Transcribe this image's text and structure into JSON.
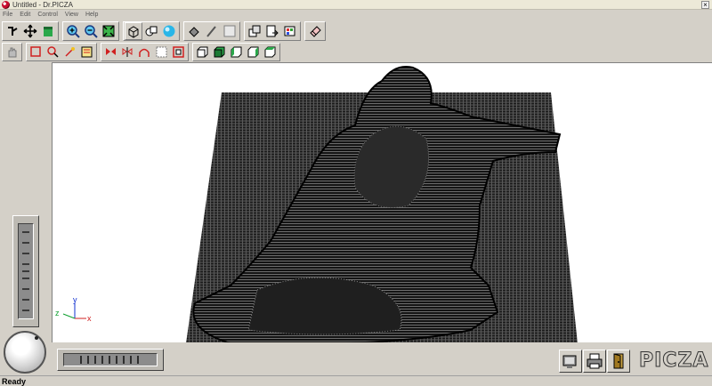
{
  "window": {
    "title": "Untitled - Dr.PICZA",
    "close_glyph": "×"
  },
  "menu": [
    "File",
    "Edit",
    "Control",
    "View",
    "Help"
  ],
  "toolbar_top": [
    {
      "name": "select-tool-icon"
    },
    {
      "name": "move-tool-icon"
    },
    {
      "name": "paint-bucket-icon"
    },
    {
      "name": "zoom-in-icon"
    },
    {
      "name": "zoom-out-icon"
    },
    {
      "name": "fit-view-icon"
    },
    {
      "name": "wireframe-view-icon"
    },
    {
      "name": "solid-view-icon"
    },
    {
      "name": "shaded-sphere-icon"
    },
    {
      "name": "fill-tool-icon"
    },
    {
      "name": "brush-tool-icon"
    },
    {
      "name": "blank-box-icon"
    },
    {
      "name": "copy-layers-icon"
    },
    {
      "name": "export-icon"
    },
    {
      "name": "color-settings-icon"
    },
    {
      "name": "eraser-icon"
    }
  ],
  "toolbar_bottom": [
    {
      "name": "hand-tool-icon"
    },
    {
      "name": "rect-select-icon"
    },
    {
      "name": "zoom-select-icon"
    },
    {
      "name": "magic-wand-icon"
    },
    {
      "name": "crop-new-icon"
    },
    {
      "name": "flip-horizontal-icon"
    },
    {
      "name": "mirror-icon"
    },
    {
      "name": "arch-icon"
    },
    {
      "name": "grid-toggle-icon"
    },
    {
      "name": "frame-icon"
    },
    {
      "name": "view-front-icon"
    },
    {
      "name": "view-top-icon"
    },
    {
      "name": "view-left-icon"
    },
    {
      "name": "view-right-icon"
    },
    {
      "name": "view-back-icon"
    }
  ],
  "axes": {
    "x": "x",
    "y": "y",
    "z": "z"
  },
  "bottom_buttons": [
    {
      "name": "monitor-icon"
    },
    {
      "name": "printer-icon"
    },
    {
      "name": "exit-door-icon"
    }
  ],
  "brand": "PICZA",
  "status": "Ready",
  "colors": {
    "viewport_bg": "#ffffff",
    "mesh": "#1a1a1a",
    "plate": "#3c3c3c",
    "face": "#d4d0c8"
  }
}
